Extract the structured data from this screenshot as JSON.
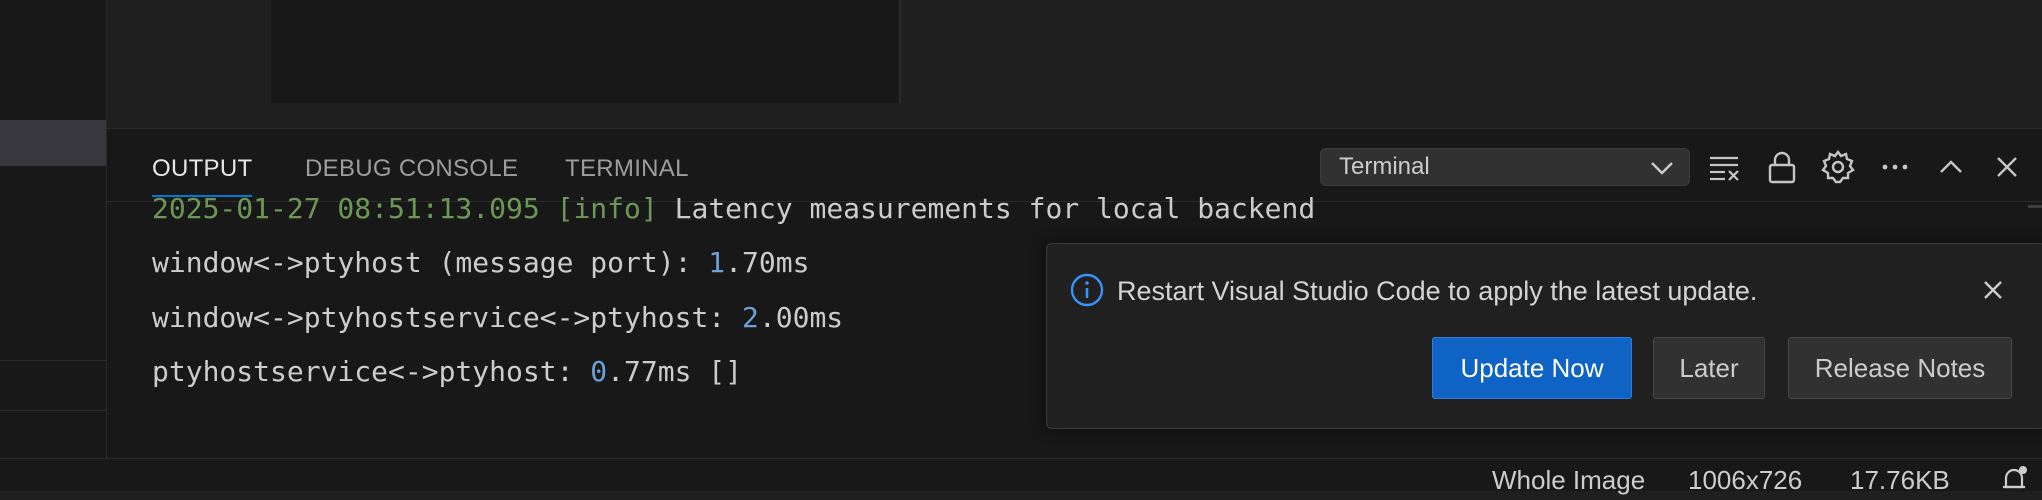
{
  "panel": {
    "tabs": [
      {
        "label": "OUTPUT",
        "active": true
      },
      {
        "label": "DEBUG CONSOLE",
        "active": false
      },
      {
        "label": "TERMINAL",
        "active": false
      }
    ],
    "output_channel": "Terminal",
    "toolbar_icons": [
      "clear-output-icon",
      "lock-icon",
      "gear-icon",
      "more-actions-icon",
      "maximize-panel-icon",
      "close-panel-icon"
    ]
  },
  "output": {
    "line0": {
      "timestamp": "2025-01-27 08:51:13.095",
      "level": "[info]",
      "text": "Latency measurements for local backend"
    },
    "line1": {
      "prefix": "window<->ptyhost (message port): ",
      "num": "1",
      "suffix": ".70ms"
    },
    "line2": {
      "prefix": "window<->ptyhostservice<->ptyhost: ",
      "num": "2",
      "suffix": ".00ms"
    },
    "line3": {
      "prefix": "ptyhostservice<->ptyhost: ",
      "num": "0",
      "suffix": ".77ms []"
    }
  },
  "notification": {
    "message": "Restart Visual Studio Code to apply the latest update.",
    "buttons": {
      "update": "Update Now",
      "later": "Later",
      "notes": "Release Notes"
    }
  },
  "statusbar": {
    "image_label": "Whole Image",
    "dimensions": "1006x726",
    "file_size": "17.76KB"
  },
  "colors": {
    "accent": "#0078d4",
    "primary_button": "#0e63c4",
    "number": "#6f9fd8",
    "timestamp": "#6a9955"
  }
}
